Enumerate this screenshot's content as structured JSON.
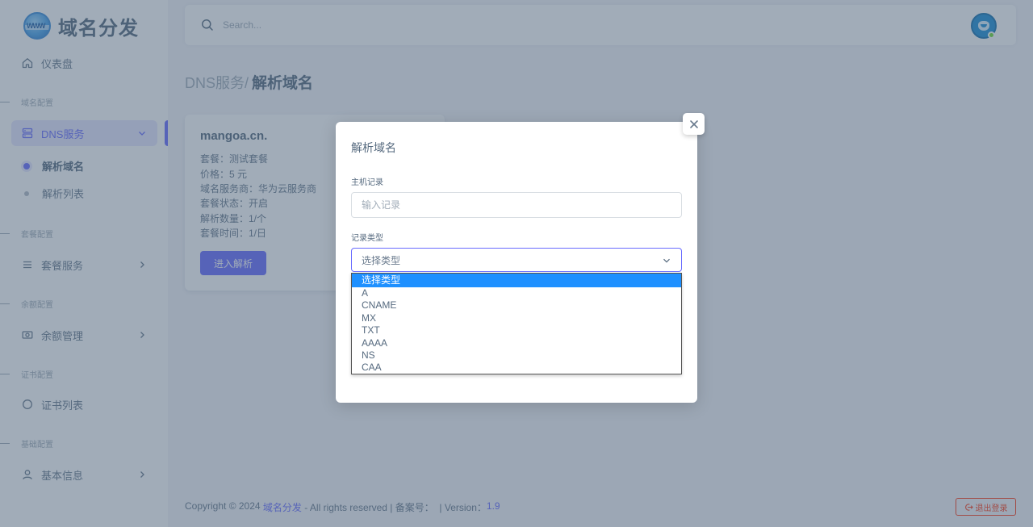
{
  "brand": {
    "name": "域名分发",
    "logo_text": "WWW"
  },
  "sidebar": {
    "dashboard": "仪表盘",
    "sections": {
      "domain_config": "域名配置",
      "package_config": "套餐配置",
      "balance_config": "余额配置",
      "cert_config": "证书配置",
      "basic_config": "基础配置"
    },
    "dns_service": "DNS服务",
    "dns_sub": {
      "resolve_domain": "解析域名",
      "resolve_list": "解析列表"
    },
    "package_service": "套餐服务",
    "balance_manage": "余额管理",
    "cert_list": "证书列表",
    "basic_info": "基本信息"
  },
  "navbar": {
    "search_placeholder": "Search..."
  },
  "breadcrumb": {
    "parent": "DNS服务/",
    "current": "解析域名"
  },
  "card": {
    "domain": "mangoa.cn.",
    "package": "套餐：测试套餐",
    "price": "价格：5 元",
    "provider": "域名服务商：华为云服务商",
    "status": "套餐状态：开启",
    "count": "解析数量：1/个",
    "time": "套餐时间：1/日",
    "button": "进入解析"
  },
  "footer": {
    "prefix": "Copyright © 2024 ",
    "site": "域名分发",
    "middle": " - All rights reserved | 备案号：  | Version：",
    "version": "1.9",
    "logout": "退出登录"
  },
  "modal": {
    "title": "解析域名",
    "host_label": "主机记录",
    "host_placeholder": "输入记录",
    "type_label": "记录类型",
    "type_selected": "选择类型",
    "type_options": [
      "选择类型",
      "A",
      "CNAME",
      "MX",
      "TXT",
      "AAAA",
      "NS",
      "CAA"
    ]
  },
  "colors": {
    "primary": "#696cff",
    "danger": "#ff3e1d",
    "online": "#71dd37"
  }
}
